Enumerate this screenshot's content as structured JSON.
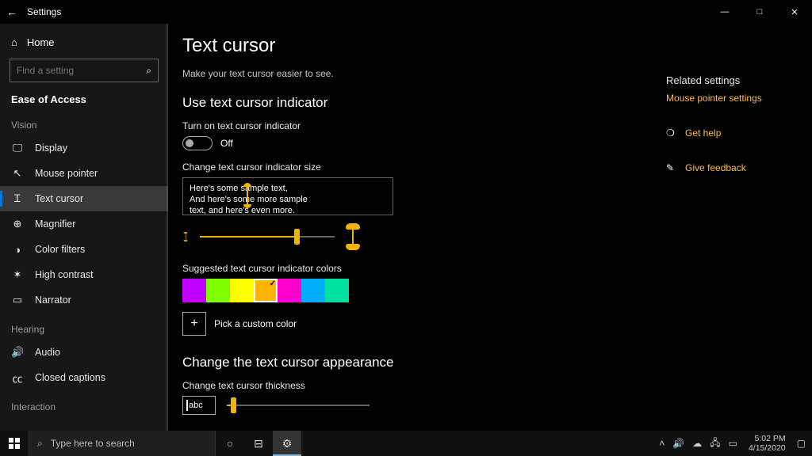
{
  "window": {
    "title": "Settings"
  },
  "sidebar": {
    "home": "Home",
    "search_placeholder": "Find a setting",
    "section": "Ease of Access",
    "groups": {
      "vision": "Vision",
      "hearing": "Hearing",
      "interaction": "Interaction"
    },
    "items": {
      "display": "Display",
      "mouse_pointer": "Mouse pointer",
      "text_cursor": "Text cursor",
      "magnifier": "Magnifier",
      "color_filters": "Color filters",
      "high_contrast": "High contrast",
      "narrator": "Narrator",
      "audio": "Audio",
      "closed_captions": "Closed captions"
    }
  },
  "main": {
    "title": "Text cursor",
    "subtitle": "Make your text cursor easier to see.",
    "section_indicator": "Use text cursor indicator",
    "toggle_label": "Turn on text cursor indicator",
    "toggle_state": "Off",
    "size_label": "Change text cursor indicator size",
    "sample_line1": "Here's some sample text,",
    "sample_line2": "And here's some more sample",
    "sample_line3": "text, and here's even more.",
    "colors_label": "Suggested text cursor indicator colors",
    "colors": [
      "#c000ff",
      "#80ff00",
      "#ffff00",
      "#ffb400",
      "#ff00cc",
      "#00b0ff",
      "#00e0a0"
    ],
    "selected_color_index": 3,
    "custom_label": "Pick a custom color",
    "section_appearance": "Change the text cursor appearance",
    "thickness_label": "Change text cursor thickness",
    "abc_sample": "abc"
  },
  "right": {
    "heading": "Related settings",
    "link": "Mouse pointer settings",
    "help": "Get help",
    "feedback": "Give feedback"
  },
  "taskbar": {
    "search_placeholder": "Type here to search",
    "time": "5:02 PM",
    "date": "4/15/2020"
  }
}
